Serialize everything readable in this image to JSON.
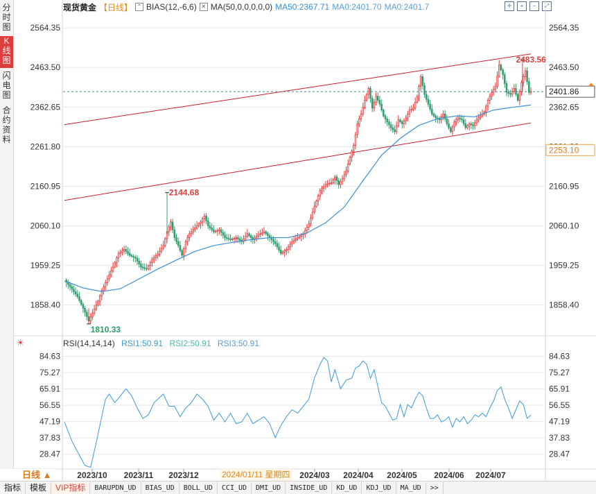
{
  "leftbar": {
    "tabs": [
      {
        "label": "分时图"
      },
      {
        "label": "K线图"
      },
      {
        "label": "闪电图"
      },
      {
        "label": "合约资料"
      }
    ],
    "active": 1
  },
  "header": {
    "symbol": "现货黄金",
    "period": "【日线】",
    "bias_label": "BIAS(12,-6,6)",
    "ma_label": "MA(50,0,0,0,0,0)",
    "ma50": "MA50:2367.71",
    "ma0a": "MA0:2401.70",
    "ma0b": "MA0:2401.7"
  },
  "rsi_header": {
    "title": "RSI(14,14,14)",
    "rsi1": "RSI1:50.91",
    "rsi2": "RSI2:50.91",
    "rsi3": "RSI3:50.91"
  },
  "colors": {
    "up": "#e03c3c",
    "down": "#2e9c6a",
    "ma": "#3b8fd6",
    "channel": "#c81e28",
    "rsi": "#3b9ad9",
    "grid": "#e8e8e8",
    "current": "#2a8fa0"
  },
  "bottom": {
    "period_select": "日线 ▲",
    "crosshair_date": "2024/01/11 星期四",
    "tabs": [
      "指标",
      "模板",
      "VIP指标",
      "BARUPDN_UD",
      "BIAS_UD",
      "BOLL_UD",
      "CCI_UD",
      "DMI_UD",
      "INSIDE_UD",
      "KD_UD",
      "KDJ_UD",
      "MA_UD",
      ">>"
    ]
  },
  "chart_data": [
    {
      "type": "candlestick",
      "title": "现货黄金【日线】",
      "ylim": [
        1780,
        2600
      ],
      "y_ticks": [
        "2564.35",
        "2463.50",
        "2362.65",
        "2261.80",
        "2160.95",
        "2060.10",
        "1959.25",
        "1858.40"
      ],
      "x_ticks": [
        "2023/10",
        "2023/11",
        "2023/12",
        "2024/03",
        "2024/04",
        "2024/05",
        "2024/06",
        "2024/07"
      ],
      "annotations": [
        {
          "label": "2483.56",
          "value": 2483.56
        },
        {
          "label": "2144.68",
          "value": 2144.68
        },
        {
          "label": "1810.33",
          "value": 1810.33
        }
      ],
      "price_tags": [
        {
          "label": "2401.86",
          "value": 2401.86
        },
        {
          "label": "2253.10",
          "value": 2253.1
        }
      ],
      "current_price": 2401.86,
      "close_path": [
        [
          0,
          1922
        ],
        [
          3,
          1905
        ],
        [
          7,
          1880
        ],
        [
          11,
          1840
        ],
        [
          13,
          1818
        ],
        [
          15,
          1838
        ],
        [
          18,
          1868
        ],
        [
          20,
          1895
        ],
        [
          23,
          1925
        ],
        [
          26,
          1955
        ],
        [
          29,
          1990
        ],
        [
          32,
          2000
        ],
        [
          35,
          1985
        ],
        [
          38,
          1978
        ],
        [
          41,
          1955
        ],
        [
          44,
          1950
        ],
        [
          47,
          1975
        ],
        [
          50,
          1988
        ],
        [
          53,
          2010
        ],
        [
          55,
          2045
        ],
        [
          57,
          2070
        ],
        [
          59,
          2030
        ],
        [
          61,
          2010
        ],
        [
          63,
          1985
        ],
        [
          65,
          2020
        ],
        [
          67,
          2040
        ],
        [
          69,
          2050
        ],
        [
          71,
          2060
        ],
        [
          73,
          2070
        ],
        [
          75,
          2085
        ],
        [
          77,
          2060
        ],
        [
          80,
          2045
        ],
        [
          83,
          2050
        ],
        [
          86,
          2030
        ],
        [
          89,
          2025
        ],
        [
          92,
          2030
        ],
        [
          95,
          2020
        ],
        [
          98,
          2040
        ],
        [
          101,
          2025
        ],
        [
          104,
          2038
        ],
        [
          107,
          2045
        ],
        [
          110,
          2030
        ],
        [
          113,
          2015
        ],
        [
          116,
          1990
        ],
        [
          119,
          2000
        ],
        [
          122,
          2020
        ],
        [
          125,
          2030
        ],
        [
          128,
          2040
        ],
        [
          131,
          2065
        ],
        [
          134,
          2110
        ],
        [
          137,
          2150
        ],
        [
          140,
          2165
        ],
        [
          143,
          2170
        ],
        [
          145,
          2185
        ],
        [
          147,
          2165
        ],
        [
          149,
          2180
        ],
        [
          151,
          2200
        ],
        [
          153,
          2235
        ],
        [
          155,
          2265
        ],
        [
          157,
          2320
        ],
        [
          159,
          2345
        ],
        [
          161,
          2380
        ],
        [
          163,
          2410
        ],
        [
          165,
          2360
        ],
        [
          167,
          2390
        ],
        [
          169,
          2370
        ],
        [
          171,
          2340
        ],
        [
          173,
          2325
        ],
        [
          175,
          2310
        ],
        [
          177,
          2300
        ],
        [
          179,
          2330
        ],
        [
          181,
          2320
        ],
        [
          183,
          2335
        ],
        [
          185,
          2355
        ],
        [
          187,
          2360
        ],
        [
          189,
          2390
        ],
        [
          191,
          2440
        ],
        [
          193,
          2395
        ],
        [
          195,
          2370
        ],
        [
          197,
          2345
        ],
        [
          199,
          2335
        ],
        [
          201,
          2330
        ],
        [
          203,
          2345
        ],
        [
          205,
          2320
        ],
        [
          207,
          2300
        ],
        [
          209,
          2325
        ],
        [
          211,
          2335
        ],
        [
          213,
          2330
        ],
        [
          215,
          2310
        ],
        [
          217,
          2320
        ],
        [
          219,
          2315
        ],
        [
          221,
          2330
        ],
        [
          223,
          2340
        ],
        [
          225,
          2350
        ],
        [
          227,
          2380
        ],
        [
          229,
          2400
        ],
        [
          231,
          2415
        ],
        [
          233,
          2470
        ],
        [
          235,
          2445
        ],
        [
          237,
          2400
        ],
        [
          239,
          2395
        ],
        [
          241,
          2410
        ],
        [
          243,
          2380
        ],
        [
          245,
          2425
        ],
        [
          247,
          2455
        ],
        [
          249,
          2400
        ],
        [
          250,
          2401.86
        ]
      ],
      "ma50_path": [
        [
          0,
          1920
        ],
        [
          10,
          1902
        ],
        [
          20,
          1893
        ],
        [
          30,
          1900
        ],
        [
          40,
          1925
        ],
        [
          50,
          1950
        ],
        [
          60,
          1973
        ],
        [
          70,
          1995
        ],
        [
          80,
          2010
        ],
        [
          90,
          2018
        ],
        [
          100,
          2025
        ],
        [
          110,
          2030
        ],
        [
          120,
          2030
        ],
        [
          130,
          2042
        ],
        [
          140,
          2068
        ],
        [
          150,
          2108
        ],
        [
          160,
          2175
        ],
        [
          170,
          2240
        ],
        [
          180,
          2283
        ],
        [
          190,
          2316
        ],
        [
          200,
          2333
        ],
        [
          210,
          2340
        ],
        [
          220,
          2338
        ],
        [
          230,
          2355
        ],
        [
          240,
          2362
        ],
        [
          250,
          2367.71
        ]
      ],
      "channel_upper": [
        [
          0,
          2318
        ],
        [
          250,
          2498
        ]
      ],
      "channel_lower": [
        [
          0,
          2125
        ],
        [
          250,
          2322
        ]
      ]
    },
    {
      "type": "line",
      "title": "RSI(14,14,14)",
      "ylim": [
        20,
        88
      ],
      "y_ticks": [
        "84.63",
        "75.27",
        "65.91",
        "56.55",
        "47.19",
        "37.83",
        "28.47"
      ],
      "series": [
        {
          "name": "RSI1",
          "points": [
            [
              0,
              47
            ],
            [
              4,
              36
            ],
            [
              8,
              28
            ],
            [
              11,
              22
            ],
            [
              14,
              21
            ],
            [
              17,
              35
            ],
            [
              20,
              50
            ],
            [
              22,
              60
            ],
            [
              24,
              63
            ],
            [
              27,
              58
            ],
            [
              30,
              62
            ],
            [
              33,
              66
            ],
            [
              36,
              62
            ],
            [
              39,
              55
            ],
            [
              42,
              49
            ],
            [
              45,
              51
            ],
            [
              48,
              58
            ],
            [
              50,
              60
            ],
            [
              53,
              63
            ],
            [
              56,
              56
            ],
            [
              59,
              56
            ],
            [
              62,
              50
            ],
            [
              65,
              55
            ],
            [
              68,
              58
            ],
            [
              71,
              63
            ],
            [
              74,
              60
            ],
            [
              77,
              56
            ],
            [
              80,
              48
            ],
            [
              83,
              52
            ],
            [
              86,
              47
            ],
            [
              89,
              52
            ],
            [
              92,
              46
            ],
            [
              95,
              47
            ],
            [
              98,
              52
            ],
            [
              101,
              46
            ],
            [
              104,
              48
            ],
            [
              107,
              50
            ],
            [
              110,
              46
            ],
            [
              113,
              38
            ],
            [
              116,
              45
            ],
            [
              119,
              50
            ],
            [
              122,
              54
            ],
            [
              125,
              52
            ],
            [
              128,
              56
            ],
            [
              131,
              60
            ],
            [
              134,
              72
            ],
            [
              137,
              80
            ],
            [
              139,
              84
            ],
            [
              141,
              82
            ],
            [
              143,
              70
            ],
            [
              145,
              77
            ],
            [
              148,
              66
            ],
            [
              151,
              71
            ],
            [
              154,
              72
            ],
            [
              156,
              78
            ],
            [
              158,
              79
            ],
            [
              160,
              82
            ],
            [
              162,
              80
            ],
            [
              164,
              72
            ],
            [
              166,
              77
            ],
            [
              168,
              67
            ],
            [
              170,
              58
            ],
            [
              172,
              56
            ],
            [
              174,
              52
            ],
            [
              176,
              48
            ],
            [
              178,
              49
            ],
            [
              180,
              57
            ],
            [
              182,
              50
            ],
            [
              184,
              57
            ],
            [
              186,
              55
            ],
            [
              188,
              60
            ],
            [
              190,
              64
            ],
            [
              192,
              62
            ],
            [
              194,
              55
            ],
            [
              196,
              49
            ],
            [
              198,
              49
            ],
            [
              200,
              51
            ],
            [
              202,
              47
            ],
            [
              204,
              48
            ],
            [
              206,
              50
            ],
            [
              208,
              44
            ],
            [
              210,
              49
            ],
            [
              212,
              47
            ],
            [
              214,
              50
            ],
            [
              216,
              46
            ],
            [
              218,
              48
            ],
            [
              220,
              51
            ],
            [
              222,
              50
            ],
            [
              224,
              52
            ],
            [
              226,
              50
            ],
            [
              228,
              55
            ],
            [
              230,
              59
            ],
            [
              232,
              65
            ],
            [
              234,
              67
            ],
            [
              236,
              60
            ],
            [
              238,
              55
            ],
            [
              240,
              49
            ],
            [
              242,
              54
            ],
            [
              244,
              59
            ],
            [
              246,
              57
            ],
            [
              248,
              49
            ],
            [
              250,
              50.91
            ]
          ]
        }
      ]
    }
  ]
}
